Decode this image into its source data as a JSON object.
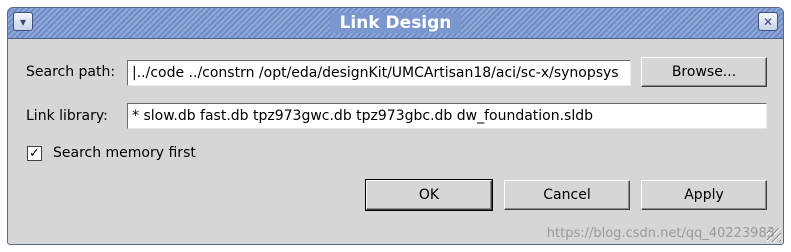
{
  "window": {
    "title": "Link Design"
  },
  "titlebar": {
    "menu_glyph": "▾",
    "close_glyph": "✕"
  },
  "search_path": {
    "label": "Search path:",
    "value": "|../code ../constrn /opt/eda/designKit/UMCArtisan18/aci/sc-x/synopsys"
  },
  "link_library": {
    "label": "Link library:",
    "value": "* slow.db fast.db tpz973gwc.db tpz973gbc.db dw_foundation.sldb"
  },
  "search_memory": {
    "label": "Search memory first",
    "checked": true,
    "check_glyph": "✓"
  },
  "buttons": {
    "browse": "Browse...",
    "ok": "OK",
    "cancel": "Cancel",
    "apply": "Apply"
  },
  "watermark": "https://blog.csdn.net/qq_40223983"
}
